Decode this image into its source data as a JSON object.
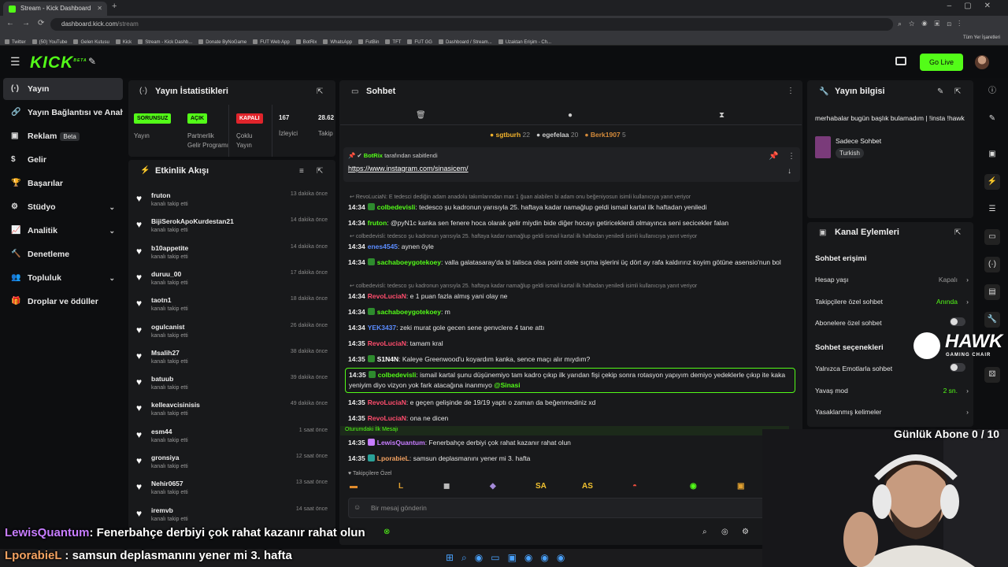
{
  "browser": {
    "tab_title": "Stream - Kick Dashboard",
    "url_host": "dashboard.kick.com",
    "url_path": "/stream",
    "bookmarks": [
      "Twitter",
      "(50) YouTube",
      "Gelen Kutusu",
      "Kick",
      "Stream - Kick Dashb...",
      "Donate ByNoGame",
      "FUT Web App",
      "BotRix",
      "WhatsApp",
      "FutBin",
      "TFT",
      "FUT GG",
      "Dashboard / Stream...",
      "Uzaktan Erişim - Ch..."
    ],
    "all_bookmarks": "Tüm Yer İşaretleri"
  },
  "header": {
    "logo": "KICK",
    "logo_sup": "BETA",
    "go_live": "Go Live"
  },
  "sidebar": {
    "items": [
      {
        "label": "Yayın",
        "icon": "broadcast-icon"
      },
      {
        "label": "Yayın Bağlantısı ve Anahtarı",
        "icon": "link-icon"
      },
      {
        "label": "Reklam",
        "badge": "Beta",
        "icon": "ad-icon"
      },
      {
        "label": "Gelir",
        "icon": "money-icon"
      },
      {
        "label": "Başarılar",
        "icon": "trophy-icon"
      },
      {
        "label": "Stüdyo",
        "icon": "studio-icon"
      },
      {
        "label": "Analitik",
        "icon": "chart-icon"
      },
      {
        "label": "Denetleme",
        "icon": "hammer-icon"
      },
      {
        "label": "Topluluk",
        "icon": "community-icon"
      },
      {
        "label": "Droplar ve ödüller",
        "icon": "gift-icon"
      }
    ]
  },
  "stats": {
    "title": "Yayın İstatistikleri",
    "tags": [
      "SORUNSUZ",
      "AÇIK",
      "KAPALI"
    ],
    "labels": [
      "Yayın",
      "Partnerlik Gelir Programı",
      "Çoklu Yayın",
      "İzleyici",
      "Takip"
    ],
    "viewers": "167",
    "followers": "28.62"
  },
  "activity": {
    "title": "Etkinlik Akışı",
    "sub": "kanalı takip etti",
    "items": [
      {
        "name": "fruton",
        "time": "13 dakika önce"
      },
      {
        "name": "BijiSerokApoKurdestan21",
        "time": "14 dakika önce"
      },
      {
        "name": "b10appetite",
        "time": "14 dakika önce"
      },
      {
        "name": "duruu_00",
        "time": "17 dakika önce"
      },
      {
        "name": "taotn1",
        "time": "18 dakika önce"
      },
      {
        "name": "ogulcanist",
        "time": "26 dakika önce"
      },
      {
        "name": "Msalih27",
        "time": "38 dakika önce"
      },
      {
        "name": "batuub",
        "time": "39 dakika önce"
      },
      {
        "name": "kelleavcisinisis",
        "time": "49 dakika önce"
      },
      {
        "name": "esm44",
        "time": "1 saat önce"
      },
      {
        "name": "gronsiya",
        "time": "12 saat önce"
      },
      {
        "name": "Nehir0657",
        "time": "13 saat önce"
      },
      {
        "name": "iremvb",
        "time": "14 saat önce"
      }
    ]
  },
  "chat": {
    "title": "Sohbet",
    "leaders": [
      {
        "name": "sgtburh",
        "count": "22"
      },
      {
        "name": "egefelaa",
        "count": "20"
      },
      {
        "name": "Berk1907",
        "count": "5"
      }
    ],
    "pinned_by": "BotRix",
    "pinned_suffix": "tarafından sabitlendi",
    "pinned_link": "https://www.instagram.com/sinasicem/",
    "messages": [
      {
        "reply": "RevoLuciaN: E tedesci dediğin adam anadolu takımlarından max 1 ğuan alabilen bi adam onu beğeniyosun isimli kullanıcıya yanıt veriyor"
      },
      {
        "time": "14:34",
        "user": "colbedevisli",
        "color": "#53fc18",
        "text": "tedesco şu kadronun yarısıyla 25. haftaya kadar namağlup geldi ismail kartal ilk haftadan yeniledi"
      },
      {
        "time": "14:34",
        "user": "fruton",
        "color": "#53fc18",
        "text": "@pyN1c kanka sen fenere hoca olarak gelir miydin bide diğer hocayı getiriceklerdi olmayınca seni secicekler falan"
      },
      {
        "reply": "colbedevisli: tedesco şu kadronun yarısıyla 25. haftaya kadar namağlup geldi ismail kartal ilk haftadan yeniledi isimli kullanıcıya yanıt veriyor"
      },
      {
        "time": "14:34",
        "user": "enes4545",
        "color": "#5b8cff",
        "text": "aynen öyle"
      },
      {
        "time": "14:34",
        "user": "sachaboeygotekoey",
        "color": "#53fc18",
        "text": "valla galatasaray'da bi talisca olsa point otele sıçma işlerini üç dört ay rafa kaldırırız koyim götüne asensio'nun bol"
      },
      {
        "reply": "colbedevisli: tedesco şu kadronun yarısıyla 25. haftaya kadar namağlup geldi ismail kartal ilk haftadan yeniledi isimli kullanıcıya yanıt veriyor"
      },
      {
        "time": "14:34",
        "user": "RevoLuciaN",
        "color": "#ff4d6d",
        "text": "e 1 puan fazla almış yani olay ne"
      },
      {
        "time": "14:34",
        "user": "sachaboeygotekoey",
        "color": "#53fc18",
        "text": "m"
      },
      {
        "time": "14:34",
        "user": "YEK3437",
        "color": "#5b8cff",
        "text": "zeki murat gole gecen sene genvclere 4 tane attı"
      },
      {
        "time": "14:35",
        "user": "RevoLuciaN",
        "color": "#ff4d6d",
        "text": "tamam kral"
      },
      {
        "time": "14:35",
        "user": "S1N4N",
        "color": "#ffffff",
        "text": "Kaleye Greenwood'u koyardım kanka, sence maçı alır mıydım?"
      },
      {
        "time": "14:35",
        "user": "colbedevisli",
        "color": "#53fc18",
        "text": "ismail kartal şunu düşünemiyo tam kadro çıkıp ilk yarıdan fişi çekip sonra rotasyon yapıyım demiyo yedeklerle çıkıp ite kaka yeniyim diyo vizyon yok fark atacağına inanmıyo",
        "mention": "@Sinasi"
      },
      {
        "time": "14:35",
        "user": "RevoLuciaN",
        "color": "#ff4d6d",
        "text": "e geçen gelişinde de 19/19 yaptı o zaman da beğenmediniz xd"
      },
      {
        "time": "14:35",
        "user": "RevoLuciaN",
        "color": "#ff4d6d",
        "text": "ona ne dicen"
      }
    ],
    "first_msg_label": "Oturumdaki İlk Mesajı",
    "after": [
      {
        "time": "14:35",
        "user": "LewisQuantum",
        "color": "#c77dff",
        "text": "Fenerbahçe derbiyi çok rahat kazanır rahat olun"
      },
      {
        "time": "14:35",
        "user": "LporabieL",
        "color": "#f4a261",
        "text": "samsun deplasmanını yener mi 3. hafta"
      }
    ],
    "follower_only": "Takipçilere Özel",
    "emotes": [
      "SA",
      "AS"
    ],
    "input_placeholder": "Bir mesaj gönderin"
  },
  "info": {
    "title": "Yayın bilgisi",
    "stream_title": "merhabalar bugün başlık bulamadım | !insta !hawk",
    "category": "Sadece Sohbet",
    "tag": "Turkish"
  },
  "actions": {
    "title": "Kanal Eylemleri",
    "access_title": "Sohbet erişimi",
    "rows": [
      {
        "label": "Hesap yaşı",
        "value": "Kapalı"
      },
      {
        "label": "Takipçilere özel sohbet",
        "value": "Anında"
      },
      {
        "label": "Abonelere özel sohbet",
        "value": ""
      }
    ],
    "options_title": "Sohbet seçenekleri",
    "rows2": [
      {
        "label": "Yalnızca Emotlarla sohbet",
        "value": ""
      },
      {
        "label": "Yavaş mod",
        "value": "2 sn."
      },
      {
        "label": "Yasaklanmış kelimeler",
        "value": ""
      }
    ]
  },
  "overlay": {
    "sponsor": "HAWK",
    "sponsor_sub": "GAMING CHAIR",
    "sub_goal": "Günlük Abone 0 / 10",
    "line1_user": "LewisQuantum",
    "line1_text": ": Fenerbahçe derbiyi çok rahat kazanır rahat olun",
    "line2_user": "LporabieL",
    "line2_text": ": samsun deplasmanını yener mi 3. hafta"
  },
  "colors": {
    "brand": "#53fc18",
    "panel": "#18191b",
    "bg": "#0d0e10"
  }
}
